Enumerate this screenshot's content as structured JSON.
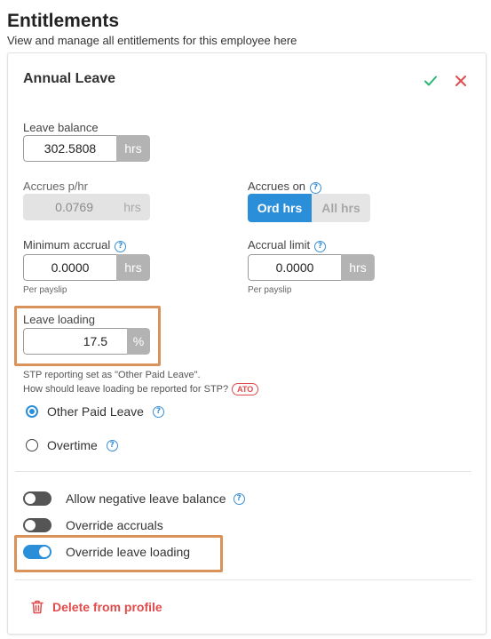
{
  "header": {
    "title": "Entitlements",
    "subtitle": "View and manage all entitlements for this employee here"
  },
  "card": {
    "title": "Annual Leave",
    "icons": {
      "confirm": "check-icon",
      "cancel": "close-icon"
    }
  },
  "leave_balance": {
    "label": "Leave balance",
    "value": "302.5808",
    "unit": "hrs"
  },
  "accrues_per_hr": {
    "label": "Accrues p/hr",
    "value": "0.0769",
    "unit": "hrs"
  },
  "accrues_on": {
    "label": "Accrues on",
    "options": [
      "Ord hrs",
      "All hrs"
    ],
    "selected": "Ord hrs"
  },
  "minimum_accrual": {
    "label": "Minimum accrual",
    "value": "0.0000",
    "unit": "hrs",
    "note": "Per payslip"
  },
  "accrual_limit": {
    "label": "Accrual limit",
    "value": "0.0000",
    "unit": "hrs",
    "note": "Per payslip"
  },
  "leave_loading": {
    "label": "Leave loading",
    "value": "17.5",
    "unit": "%"
  },
  "stp": {
    "note1": "STP reporting set as \"Other Paid Leave\".",
    "note2": "How should leave loading be reported for STP?",
    "badge": "ATO",
    "options": [
      "Other Paid Leave",
      "Overtime"
    ],
    "selected": "Other Paid Leave"
  },
  "toggles": {
    "allow_negative": {
      "label": "Allow negative leave balance",
      "on": false
    },
    "override_accruals": {
      "label": "Override accruals",
      "on": false
    },
    "override_leave_loading": {
      "label": "Override leave loading",
      "on": true
    }
  },
  "delete_label": "Delete from profile",
  "colors": {
    "accent": "#2a8fd8",
    "danger": "#e04b4b",
    "success": "#2bb673",
    "highlight": "#d9935a"
  }
}
